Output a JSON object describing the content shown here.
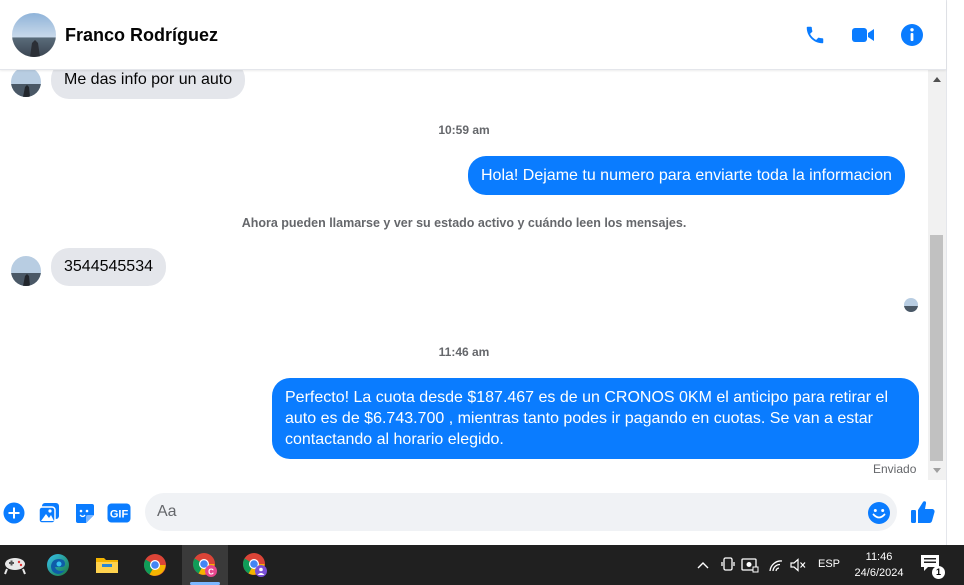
{
  "header": {
    "contact_name": "Franco Rodríguez",
    "icons": [
      "phone-icon",
      "video-icon",
      "info-icon"
    ]
  },
  "colors": {
    "accent": "#0a7cff",
    "incoming_bubble": "#e4e6eb",
    "taskbar": "#202020"
  },
  "messages": {
    "m1": "Me das info por un auto",
    "t1": "10:59 am",
    "m2": "Hola! Dejame tu numero para enviarte toda la informacion",
    "sys": "Ahora pueden llamarse y ver su estado activo y cuándo leen los mensajes.",
    "m3": "3544545534",
    "t2": "11:46 am",
    "m4": "Perfecto! La cuota desde $187.467 es de un CRONOS 0KM el anticipo para retirar el auto es de $6.743.700 , mientras tanto podes ir pagando en cuotas. Se van a estar contactando al horario elegido.",
    "status": "Enviado"
  },
  "composer": {
    "placeholder": "Aa",
    "icons": [
      "plus-icon",
      "image-icon",
      "sticker-icon",
      "gif-icon",
      "emoji-icon",
      "like-icon"
    ],
    "gif_label": "GIF"
  },
  "taskbar": {
    "apps": [
      "gamepad-icon",
      "edge-icon",
      "file-explorer-icon",
      "chrome-icon",
      "chrome-profile-icon",
      "chrome-profile2-icon"
    ],
    "language": "ESP",
    "time": "11:46",
    "date": "24/6/2024",
    "notification_count": "1"
  }
}
